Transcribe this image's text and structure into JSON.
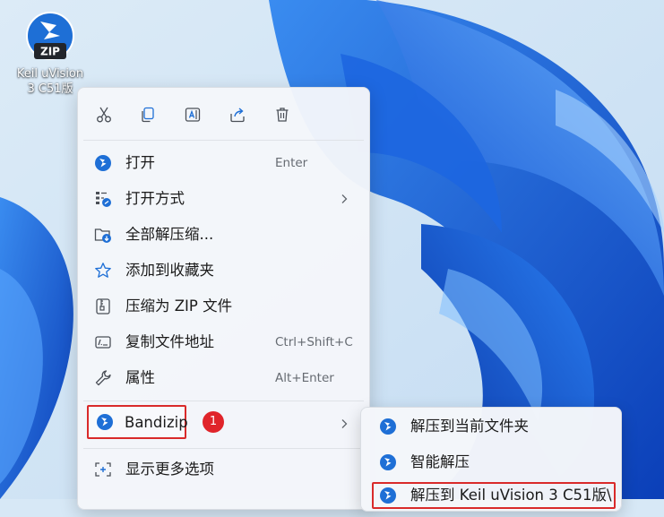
{
  "desktop": {
    "icon_label_line1": "Keil uVision",
    "icon_label_line2": "3 C51版",
    "icon_badge_text": "ZIP"
  },
  "context_menu": {
    "toolbar": [
      "cut-icon",
      "copy-icon",
      "rename-icon",
      "share-icon",
      "delete-icon"
    ],
    "items": [
      {
        "label": "打开",
        "shortcut": "Enter",
        "icon": "bandizip-icon"
      },
      {
        "label": "打开方式",
        "icon": "open-with-icon",
        "submenu": true
      },
      {
        "label": "全部解压缩...",
        "icon": "extract-all-icon"
      },
      {
        "label": "添加到收藏夹",
        "icon": "star-icon"
      },
      {
        "label": "压缩为 ZIP 文件",
        "icon": "zip-compress-icon"
      },
      {
        "label": "复制文件地址",
        "shortcut": "Ctrl+Shift+C",
        "icon": "copy-path-icon"
      },
      {
        "label": "属性",
        "shortcut": "Alt+Enter",
        "icon": "wrench-icon"
      },
      {
        "label": "Bandizip",
        "icon": "bandizip-icon",
        "submenu": true
      },
      {
        "label": "显示更多选项",
        "icon": "more-options-icon"
      }
    ],
    "step_badge": "1"
  },
  "submenu": {
    "items": [
      {
        "label": "解压到当前文件夹"
      },
      {
        "label": "智能解压"
      },
      {
        "label": "解压到 Keil uVision 3 C51版\\"
      }
    ]
  },
  "colors": {
    "accent": "#0067c0",
    "highlight_box": "#d92a2a",
    "badge": "#e0242a"
  }
}
